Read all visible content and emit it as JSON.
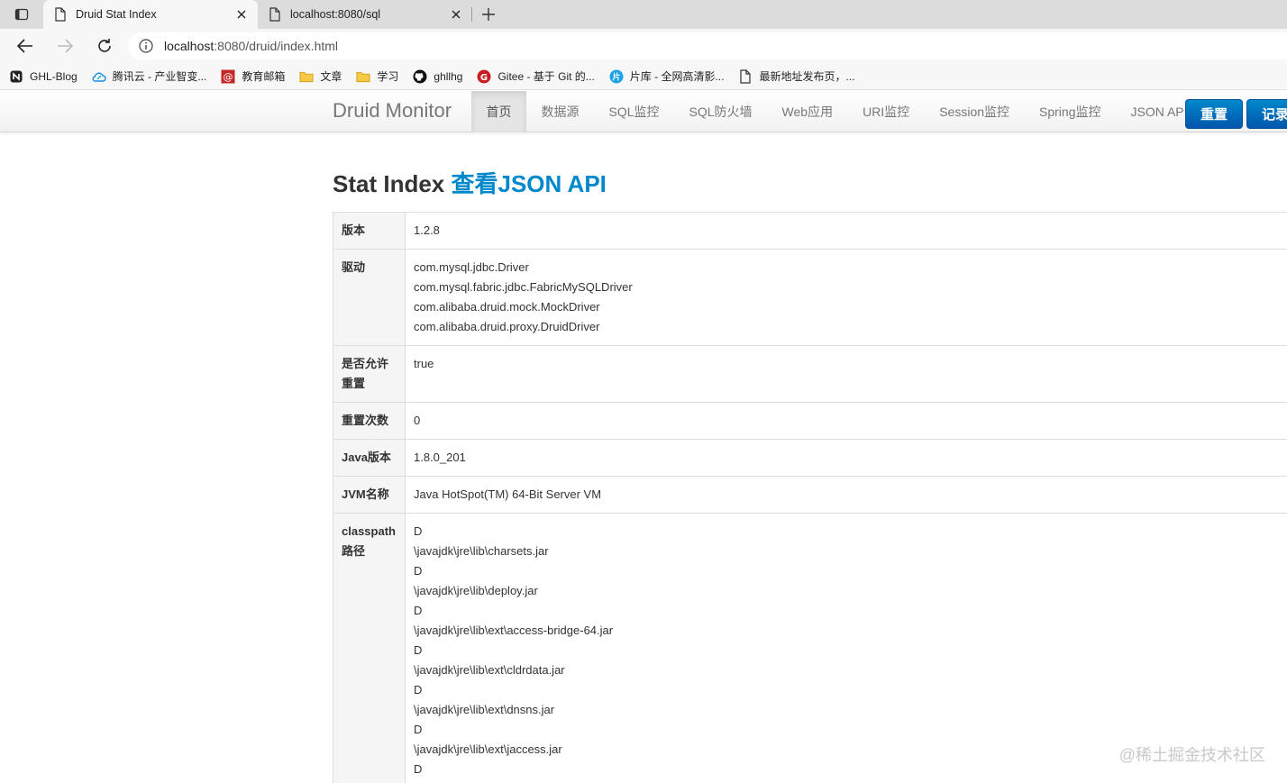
{
  "browser": {
    "tabs": [
      {
        "title": "Druid Stat Index",
        "active": true
      },
      {
        "title": "localhost:8080/sql",
        "active": false
      }
    ],
    "address": {
      "host": "localhost",
      "path": ":8080/druid/index.html"
    },
    "bookmarks": [
      {
        "label": "GHL-Blog",
        "icon": "notion-icon"
      },
      {
        "label": "腾讯云 - 产业智变...",
        "icon": "cloud-icon"
      },
      {
        "label": "教育邮箱",
        "icon": "mail-icon"
      },
      {
        "label": "文章",
        "icon": "folder-icon"
      },
      {
        "label": "学习",
        "icon": "folder-icon"
      },
      {
        "label": "ghllhg",
        "icon": "github-icon"
      },
      {
        "label": "Gitee - 基于 Git 的...",
        "icon": "gitee-icon"
      },
      {
        "label": "片库 - 全网高清影...",
        "icon": "pianku-icon"
      },
      {
        "label": "最新地址发布页，...",
        "icon": "page-icon"
      }
    ]
  },
  "app": {
    "brand": "Druid Monitor",
    "nav": [
      "首页",
      "数据源",
      "SQL监控",
      "SQL防火墙",
      "Web应用",
      "URI监控",
      "Session监控",
      "Spring监控",
      "JSON API"
    ],
    "buttons": {
      "reset": "重置",
      "log": "记录"
    }
  },
  "heading": {
    "title": "Stat Index",
    "link": "查看JSON API"
  },
  "stats": [
    {
      "label": "版本",
      "values": [
        "1.2.8"
      ]
    },
    {
      "label": "驱动",
      "values": [
        "com.mysql.jdbc.Driver",
        "com.mysql.fabric.jdbc.FabricMySQLDriver",
        "com.alibaba.druid.mock.MockDriver",
        "com.alibaba.druid.proxy.DruidDriver"
      ]
    },
    {
      "label": "是否允许重置",
      "values": [
        "true"
      ]
    },
    {
      "label": "重置次数",
      "values": [
        "0"
      ]
    },
    {
      "label": "Java版本",
      "values": [
        "1.8.0_201"
      ]
    },
    {
      "label": "JVM名称",
      "values": [
        "Java HotSpot(TM) 64-Bit Server VM"
      ]
    },
    {
      "label": "classpath路径",
      "values": [
        "D",
        "\\javajdk\\jre\\lib\\charsets.jar",
        "D",
        "\\javajdk\\jre\\lib\\deploy.jar",
        "D",
        "\\javajdk\\jre\\lib\\ext\\access-bridge-64.jar",
        "D",
        "\\javajdk\\jre\\lib\\ext\\cldrdata.jar",
        "D",
        "\\javajdk\\jre\\lib\\ext\\dnsns.jar",
        "D",
        "\\javajdk\\jre\\lib\\ext\\jaccess.jar",
        "D"
      ]
    }
  ],
  "watermark": "@稀土掘金技术社区"
}
